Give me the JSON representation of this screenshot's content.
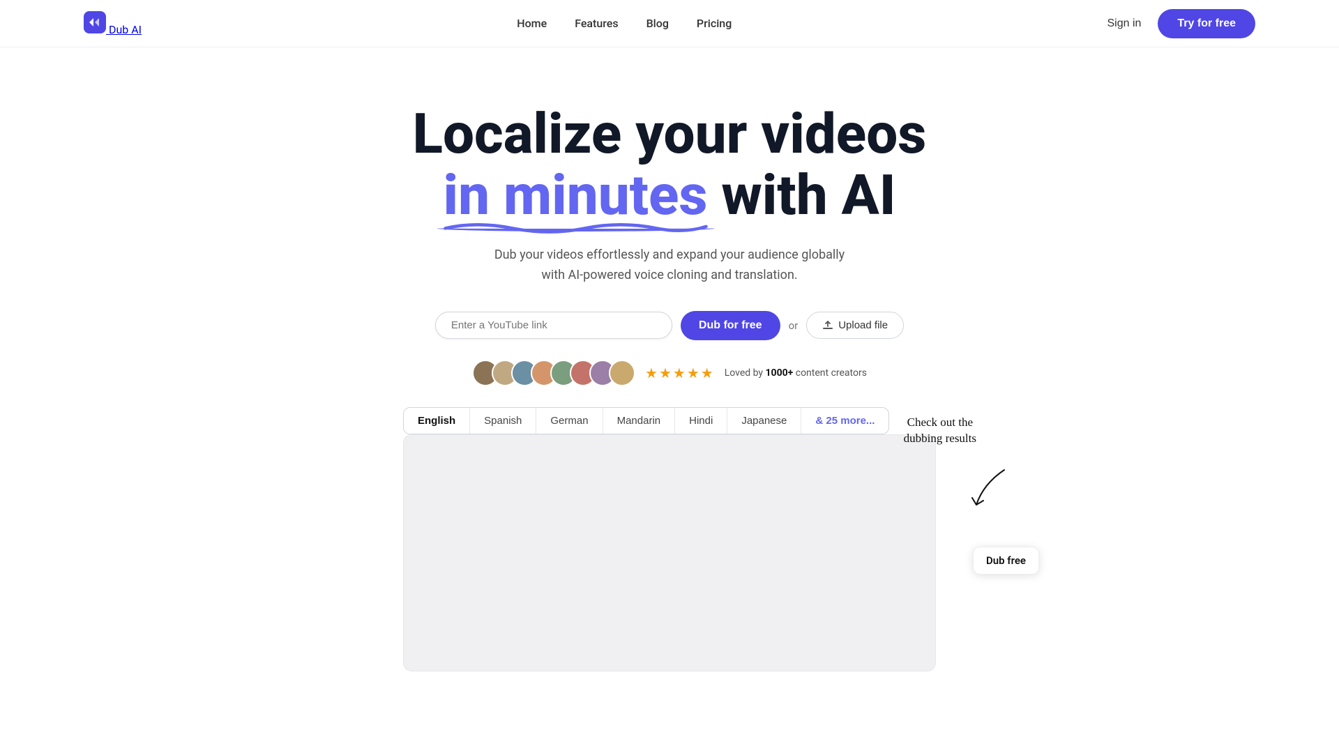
{
  "nav": {
    "logo_text": "Dub AI",
    "links": [
      {
        "label": "Home",
        "id": "home"
      },
      {
        "label": "Features",
        "id": "features"
      },
      {
        "label": "Blog",
        "id": "blog"
      },
      {
        "label": "Pricing",
        "id": "pricing"
      }
    ],
    "sign_in": "Sign in",
    "try_free": "Try for free"
  },
  "hero": {
    "title_line1": "Localize your videos",
    "title_highlight": "in minutes",
    "title_line2_rest": " with AI",
    "subtitle": "Dub your videos effortlessly and expand your audience globally with AI-powered voice cloning and translation.",
    "input_placeholder": "Enter a YouTube link",
    "dub_btn": "Dub for free",
    "or_text": "or",
    "upload_btn": "Upload file",
    "loved_prefix": "Loved by ",
    "loved_count": "1000+",
    "loved_suffix": " content creators",
    "stars": "★★★★★"
  },
  "language_tabs": [
    {
      "label": "English",
      "active": true
    },
    {
      "label": "Spanish",
      "active": false
    },
    {
      "label": "German",
      "active": false
    },
    {
      "label": "Mandarin",
      "active": false
    },
    {
      "label": "Hindi",
      "active": false
    },
    {
      "label": "Japanese",
      "active": false
    },
    {
      "label": "& 25 more...",
      "active": false,
      "more": true
    }
  ],
  "annotation": {
    "text": "Check out the\ndubbing results",
    "dub_free_badge": "Dub free"
  },
  "avatars": [
    {
      "color": "#8b7355",
      "initials": ""
    },
    {
      "color": "#c0a882",
      "initials": ""
    },
    {
      "color": "#6b8fa3",
      "initials": ""
    },
    {
      "color": "#d4956a",
      "initials": ""
    },
    {
      "color": "#7a9e7e",
      "initials": ""
    },
    {
      "color": "#c4736a",
      "initials": ""
    },
    {
      "color": "#9b7fa6",
      "initials": ""
    },
    {
      "color": "#c9a96e",
      "initials": ""
    }
  ]
}
